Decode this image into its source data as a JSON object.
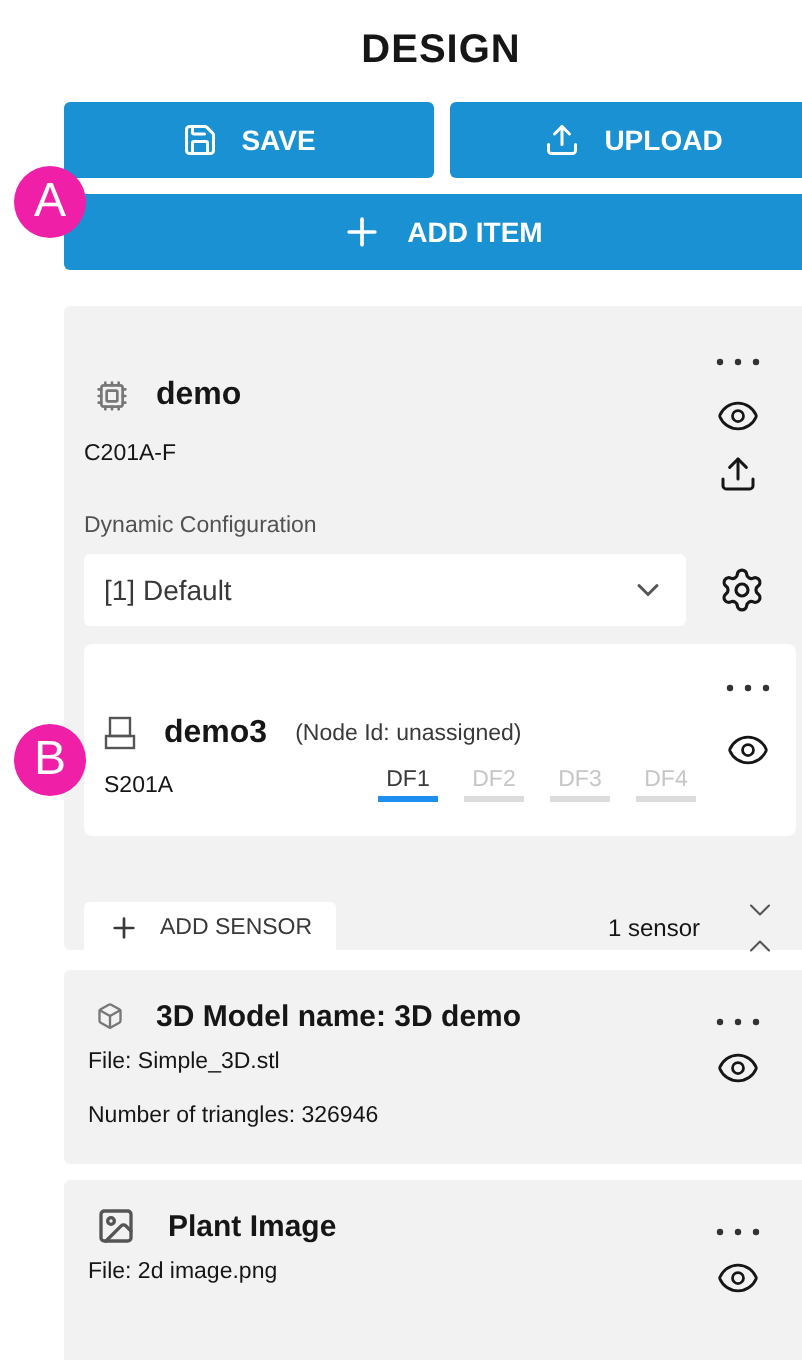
{
  "title": "DESIGN",
  "actions": [
    {
      "kind": "save",
      "label": "SAVE"
    },
    {
      "kind": "upload",
      "label": "UPLOAD"
    }
  ],
  "add_item": {
    "label": "ADD ITEM"
  },
  "controller": {
    "name": "demo",
    "model": "C201A-F",
    "config_label": "Dynamic Configuration",
    "config_value": "[1] Default",
    "node": {
      "name": "demo3",
      "node_id": "(Node Id: unassigned)",
      "model": "S201A",
      "tabs": [
        {
          "label": "DF1",
          "selected": true
        },
        {
          "label": "DF2",
          "selected": false
        },
        {
          "label": "DF3",
          "selected": false
        },
        {
          "label": "DF4",
          "selected": false
        }
      ]
    },
    "add_sensor": "ADD SENSOR",
    "sensor_count": "1 sensor"
  },
  "items": [
    {
      "kind": "model",
      "title": "3D Model name: 3D demo",
      "lines": [
        "File: Simple_3D.stl",
        "Number of triangles: 326946"
      ]
    },
    {
      "kind": "image",
      "title": "Plant Image",
      "lines": [
        "File: 2d image.png"
      ]
    }
  ],
  "callouts": [
    {
      "label": "A"
    },
    {
      "label": "B"
    }
  ]
}
